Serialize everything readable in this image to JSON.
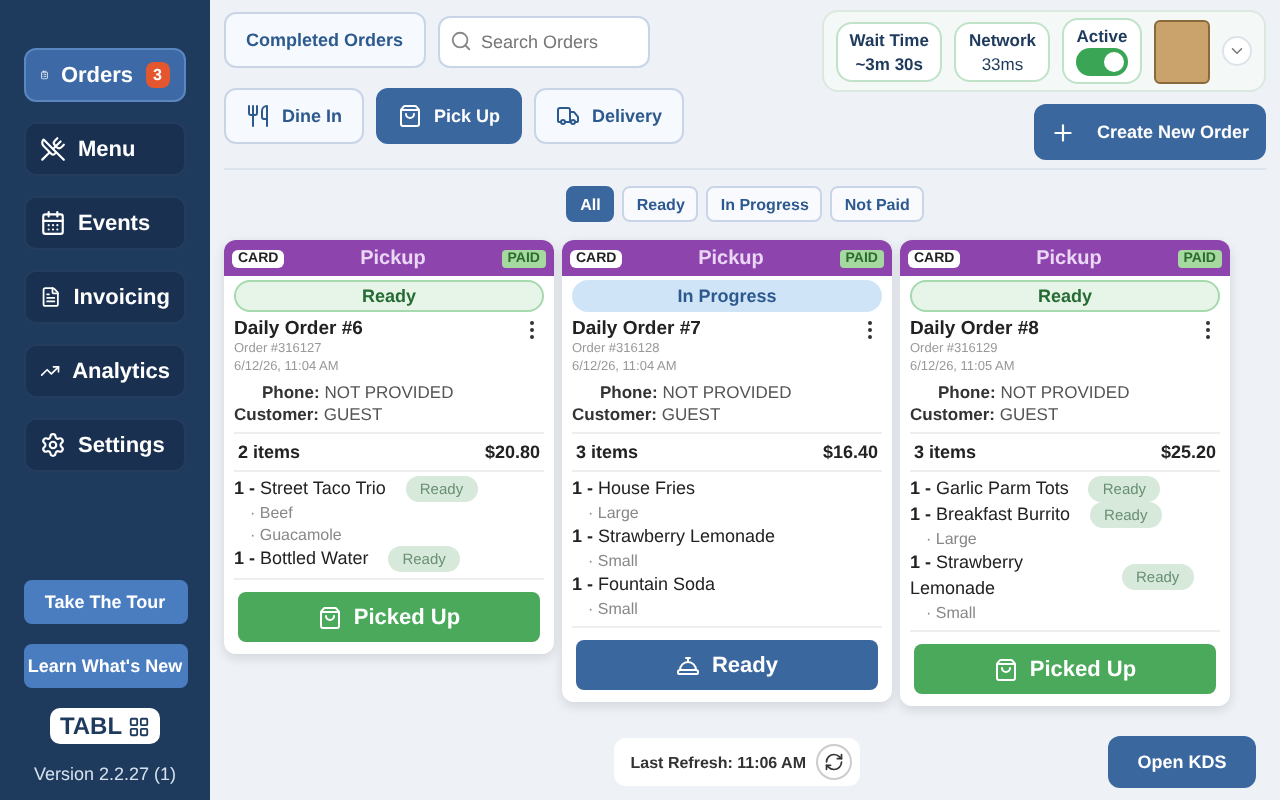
{
  "sidebar": {
    "items": [
      {
        "label": "Orders",
        "selected": true,
        "badge": "3"
      },
      {
        "label": "Menu",
        "selected": false
      },
      {
        "label": "Events",
        "selected": false
      },
      {
        "label": "Invoicing",
        "selected": false
      },
      {
        "label": "Analytics",
        "selected": false
      },
      {
        "label": "Settings",
        "selected": false
      }
    ],
    "buttons": [
      "Take The Tour",
      "Learn What's New"
    ],
    "logo": "TABL",
    "version": "Version 2.2.27 (1)"
  },
  "toolbar": {
    "completed_button": "Completed Orders",
    "search": {
      "placeholder": "Search Orders"
    },
    "order_types": [
      {
        "label": "Dine In",
        "selected": false
      },
      {
        "label": "Pick Up",
        "selected": true
      },
      {
        "label": "Delivery",
        "selected": false
      }
    ],
    "create_button": "Create New Order"
  },
  "status_panel": {
    "wait_time": {
      "label": "Wait Time",
      "value": "~3m 30s"
    },
    "network": {
      "label": "Network",
      "value": "33ms"
    },
    "active": {
      "label": "Active",
      "on": true
    }
  },
  "filters": [
    {
      "label": "All",
      "selected": true
    },
    {
      "label": "Ready",
      "selected": false
    },
    {
      "label": "In Progress",
      "selected": false
    },
    {
      "label": "Not Paid",
      "selected": false
    }
  ],
  "orders": [
    {
      "payment": "CARD",
      "type": "Pickup",
      "paid": "PAID",
      "status": {
        "label": "Ready",
        "kind": "ready"
      },
      "title": "Daily Order #6",
      "order_number": "Order #316127",
      "datetime": "6/12/26, 11:04 AM",
      "phone_label": "Phone:",
      "phone": "NOT PROVIDED",
      "customer_label": "Customer:",
      "customer": "GUEST",
      "count": "2 items",
      "total": "$20.80",
      "items": [
        {
          "text": "**1 -** Street Taco Trio",
          "status": "Ready",
          "modifiers": [
            "· Beef",
            "· Guacamole"
          ]
        },
        {
          "text": "**1 -** Bottled Water",
          "status": "Ready"
        }
      ],
      "action": {
        "label": "Picked Up",
        "kind": "picked_up"
      }
    },
    {
      "payment": "CARD",
      "type": "Pickup",
      "paid": "PAID",
      "status": {
        "label": "In Progress",
        "kind": "in_progress"
      },
      "title": "Daily Order #7",
      "order_number": "Order #316128",
      "datetime": "6/12/26, 11:04 AM",
      "phone_label": "Phone:",
      "phone": "NOT PROVIDED",
      "customer_label": "Customer:",
      "customer": "GUEST",
      "count": "3 items",
      "total": "$16.40",
      "items": [
        {
          "text": "**1 -** House Fries",
          "modifiers": [
            "· Large"
          ]
        },
        {
          "text": "**1 -** Strawberry Lemonade",
          "modifiers": [
            "· Small"
          ]
        },
        {
          "text": "**1 -** Fountain Soda",
          "modifiers": [
            "· Small"
          ]
        }
      ],
      "action": {
        "label": "Ready",
        "kind": "ready"
      }
    },
    {
      "payment": "CARD",
      "type": "Pickup",
      "paid": "PAID",
      "status": {
        "label": "Ready",
        "kind": "ready"
      },
      "title": "Daily Order #8",
      "order_number": "Order #316129",
      "datetime": "6/12/26, 11:05 AM",
      "phone_label": "Phone:",
      "phone": "NOT PROVIDED",
      "customer_label": "Customer:",
      "customer": "GUEST",
      "count": "3 items",
      "total": "$25.20",
      "items": [
        {
          "text": "**1 -** Garlic Parm Tots",
          "status": "Ready"
        },
        {
          "text": "**1 -** Breakfast Burrito",
          "status": "Ready",
          "modifiers": [
            "· Large"
          ]
        },
        {
          "text": "**1 -** Strawberry Lemonade",
          "status": "Ready",
          "modifiers": [
            "· Small"
          ]
        }
      ],
      "action": {
        "label": "Picked Up",
        "kind": "picked_up"
      }
    }
  ],
  "footer": {
    "last_refresh": "Last Refresh: 11:06 AM",
    "kds_button": "Open KDS"
  }
}
